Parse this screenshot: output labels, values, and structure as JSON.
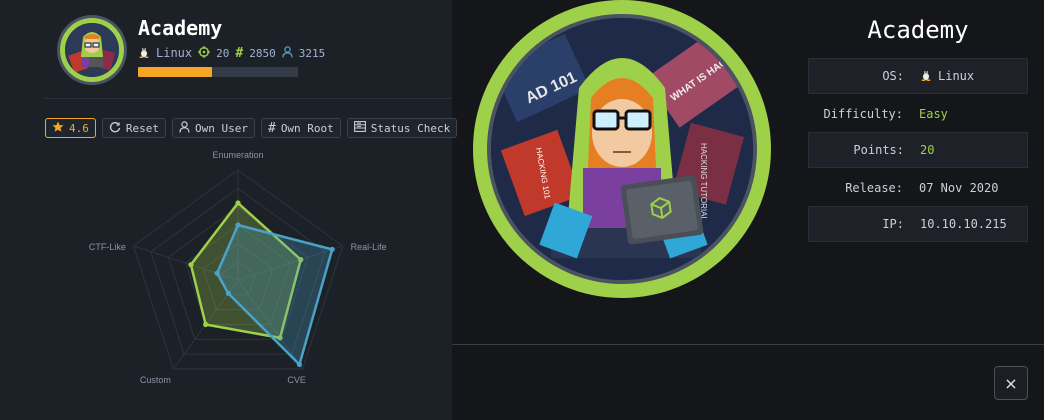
{
  "machine": {
    "name": "Academy",
    "os": "Linux",
    "points_own": "20",
    "score": "2850",
    "users": "3215",
    "progress": 0.46,
    "rating": "4.6"
  },
  "actions": {
    "rating_label": "4.6",
    "reset_label": "Reset",
    "own_user_label": "Own User",
    "own_root_label": "Own Root",
    "status_check_label": "Status Check"
  },
  "chart_data": {
    "type": "radar",
    "axes": [
      "Enumeration",
      "Real-Life",
      "CVE",
      "Custom",
      "CTF-Like"
    ],
    "scale_max": 10,
    "rings": 6,
    "series": [
      {
        "color": "#9fd04a",
        "values": [
          7,
          6,
          6.5,
          5,
          4.5
        ]
      },
      {
        "color": "#4aa3c7",
        "values": [
          5,
          9,
          9.5,
          1.5,
          2
        ]
      }
    ]
  },
  "info": {
    "title": "Academy",
    "rows": [
      {
        "key": "OS:",
        "value": "Linux"
      },
      {
        "key": "Difficulty:",
        "value": "Easy"
      },
      {
        "key": "Points:",
        "value": "20"
      },
      {
        "key": "Release:",
        "value": "07 Nov 2020"
      },
      {
        "key": "IP:",
        "value": "10.10.10.215"
      }
    ]
  },
  "close_icon": "×",
  "colors": {
    "accent": "#9fd04a",
    "rating": "#f5a623",
    "blue": "#4aa3c7"
  }
}
